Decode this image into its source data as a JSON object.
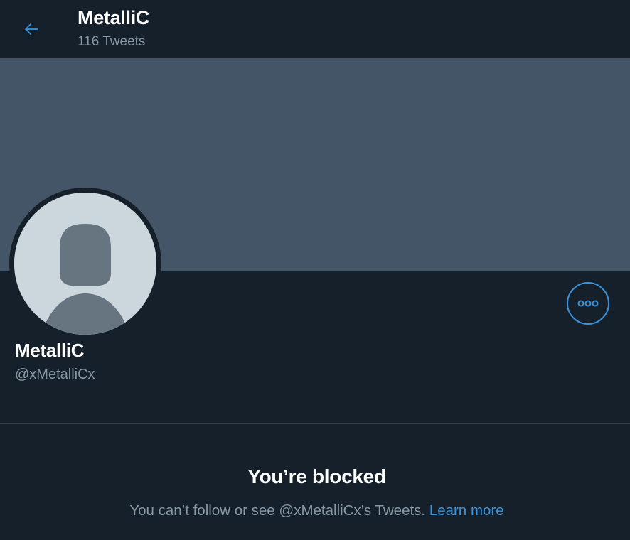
{
  "header": {
    "title": "MetalliC",
    "tweet_count": "116 Tweets",
    "back_icon": "arrow-left-icon"
  },
  "profile": {
    "name": "MetalliC",
    "handle": "@xMetalliCx",
    "more_icon": "more-horizontal-icon",
    "avatar_icon": "default-avatar-icon"
  },
  "blocked": {
    "title": "You’re blocked",
    "message": "You can’t follow or see @xMetalliCx’s Tweets.",
    "link": "Learn more"
  },
  "colors": {
    "background": "#15202b",
    "banner": "#435566",
    "accent": "#3b94d9",
    "secondary_text": "#8899a6",
    "avatar_bg": "#ccd6dd",
    "avatar_silhouette": "#66757f"
  }
}
